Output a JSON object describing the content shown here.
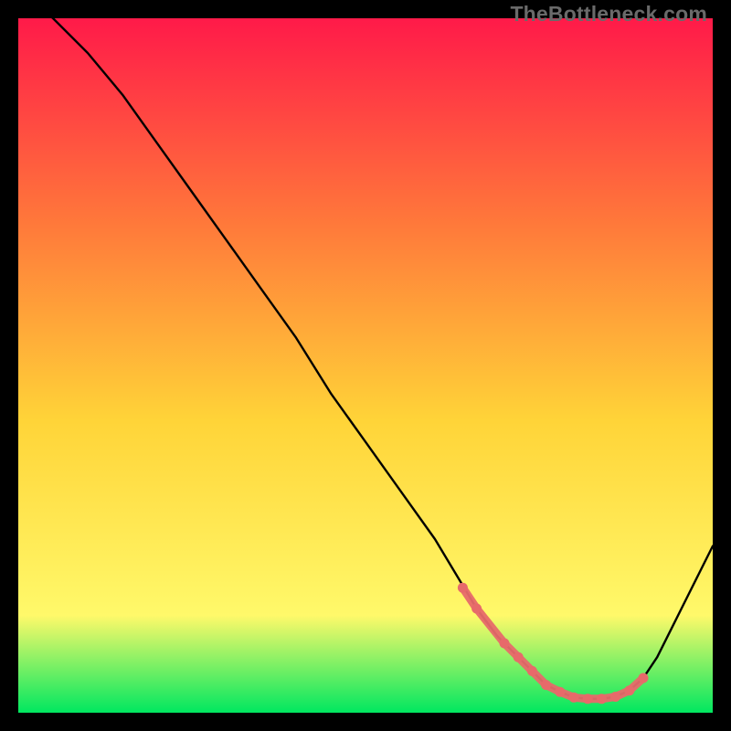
{
  "watermark": "TheBottleneck.com",
  "colors": {
    "gradient_top": "#ff1a49",
    "gradient_upper_mid": "#ff7a3a",
    "gradient_mid": "#ffd438",
    "gradient_lower_mid": "#fff96a",
    "gradient_bottom": "#00e760",
    "curve": "#000000",
    "markers": "#e76a6a",
    "background": "#000000"
  },
  "chart_data": {
    "type": "line",
    "title": "",
    "xlabel": "",
    "ylabel": "",
    "xlim": [
      0,
      100
    ],
    "ylim": [
      0,
      100
    ],
    "series": [
      {
        "name": "bottleneck-curve",
        "x": [
          0,
          5,
          10,
          15,
          20,
          25,
          30,
          35,
          40,
          45,
          50,
          55,
          60,
          63,
          66,
          69,
          72,
          74,
          76,
          78,
          80,
          82,
          84,
          86,
          88,
          90,
          92,
          94,
          96,
          98,
          100
        ],
        "values": [
          104,
          100,
          95,
          89,
          82,
          75,
          68,
          61,
          54,
          46,
          39,
          32,
          25,
          20,
          15,
          11,
          8,
          6,
          4,
          3,
          2.2,
          2,
          2,
          2.3,
          3.2,
          5,
          8,
          12,
          16,
          20,
          24
        ]
      }
    ],
    "markers": {
      "name": "highlight-zone",
      "x": [
        64,
        66,
        70,
        72,
        74,
        76,
        78,
        80,
        82,
        84,
        86,
        88,
        90
      ],
      "values": [
        18,
        15,
        10,
        8,
        6,
        4,
        3,
        2.2,
        2,
        2,
        2.3,
        3.2,
        5
      ]
    }
  }
}
